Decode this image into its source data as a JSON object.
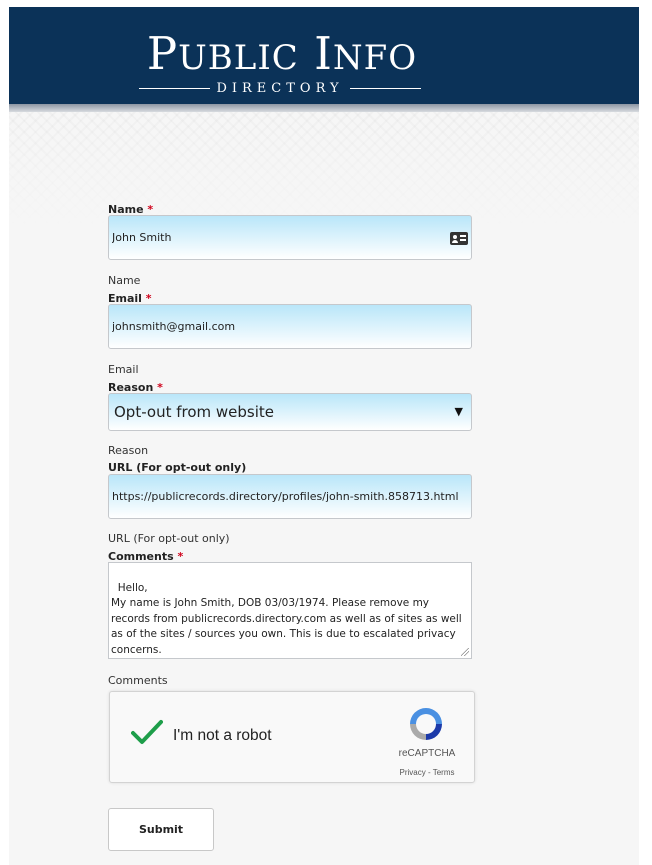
{
  "header": {
    "logo_title_first_initial": "P",
    "logo_title_first_rest": "UBLIC",
    "logo_title_second_initial": "I",
    "logo_title_second_rest": "NFO",
    "logo_subtitle": "DIRECTORY",
    "background_color": "#0b3258"
  },
  "form": {
    "name": {
      "label": "Name",
      "required_mark": "*",
      "value": "John Smith",
      "helper": "Name",
      "icon": "contact-card-icon"
    },
    "email": {
      "label": "Email",
      "required_mark": "*",
      "value": "johnsmith@gmail.com",
      "helper": "Email"
    },
    "reason": {
      "label": "Reason",
      "required_mark": "*",
      "selected": "Opt-out from website",
      "helper": "Reason",
      "icon": "dropdown-arrow-icon"
    },
    "url": {
      "label": "URL (For opt-out only)",
      "value": "https://publicrecords.directory/profiles/john-smith.858713.html",
      "helper": "URL (For opt-out only)"
    },
    "comments": {
      "label": "Comments",
      "required_mark": "*",
      "value": "Hello,\nMy name is John Smith, DOB 03/03/1974. Please remove my records from publicrecords.directory.com as well as of sites as well as of the sites / sources you own. This is due to escalated privacy concerns.",
      "helper": "Comments"
    },
    "captcha": {
      "label": "I'm not a robot",
      "brand": "reCAPTCHA",
      "links": "Privacy - Terms",
      "checked": true,
      "check_color": "#1e9e4a"
    },
    "submit_label": "Submit"
  },
  "colors": {
    "required": "#d0021b",
    "input_gradient_top": "#b9e6f9"
  }
}
